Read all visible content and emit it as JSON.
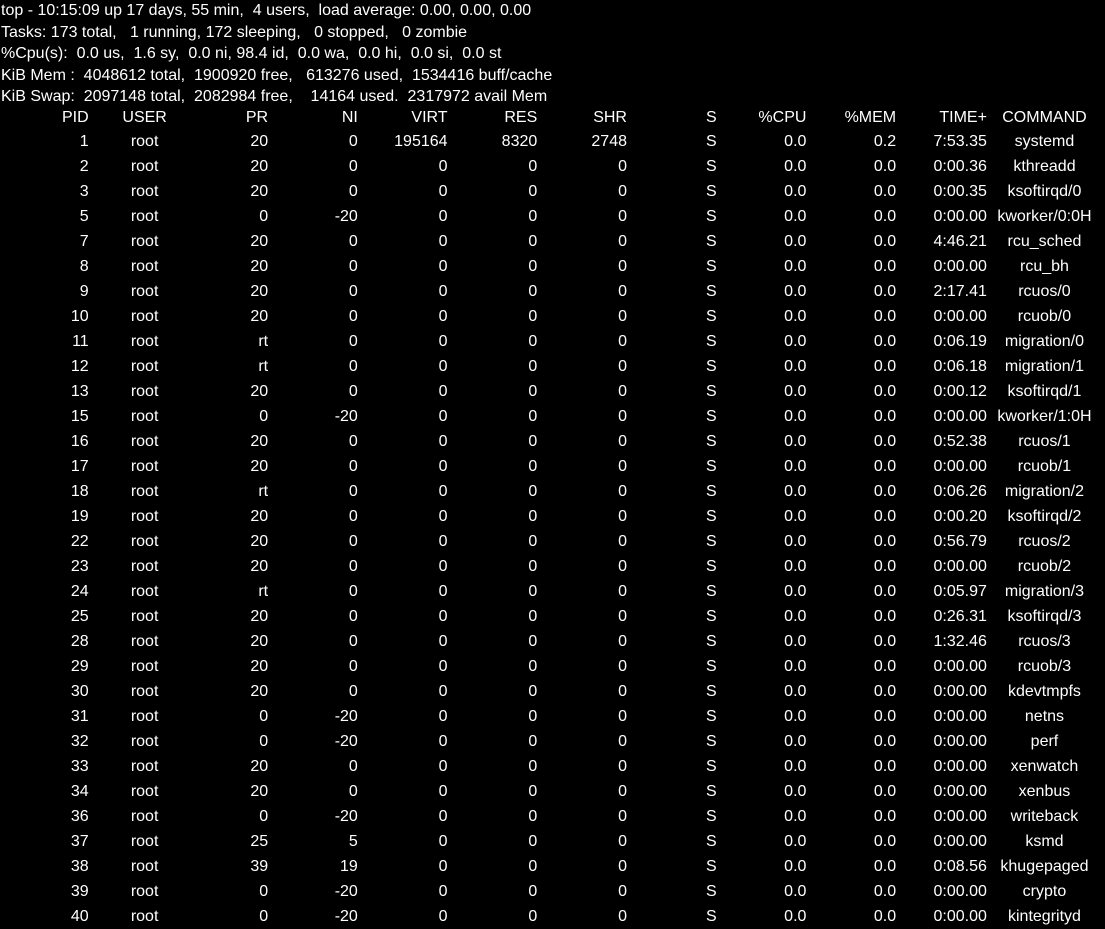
{
  "summary": {
    "line1": "top - 10:15:09 up 17 days, 55 min,  4 users,  load average: 0.00, 0.00, 0.00",
    "line2": "Tasks: 173 total,   1 running, 172 sleeping,   0 stopped,   0 zombie",
    "line3": "%Cpu(s):  0.0 us,  1.6 sy,  0.0 ni, 98.4 id,  0.0 wa,  0.0 hi,  0.0 si,  0.0 st",
    "line4": "KiB Mem :  4048612 total,  1900920 free,   613276 used,  1534416 buff/cache",
    "line5": "KiB Swap:  2097148 total,  2082984 free,    14164 used.  2317972 avail Mem"
  },
  "columns": [
    "PID",
    "USER",
    "PR",
    "NI",
    "VIRT",
    "RES",
    "SHR",
    "S",
    "%CPU",
    "%MEM",
    "TIME+",
    "COMMAND"
  ],
  "processes": [
    {
      "pid": "1",
      "user": "root",
      "pr": "20",
      "ni": "0",
      "virt": "195164",
      "res": "8320",
      "shr": "2748",
      "s": "S",
      "cpu": "0.0",
      "mem": "0.2",
      "time": "7:53.35",
      "command": "systemd"
    },
    {
      "pid": "2",
      "user": "root",
      "pr": "20",
      "ni": "0",
      "virt": "0",
      "res": "0",
      "shr": "0",
      "s": "S",
      "cpu": "0.0",
      "mem": "0.0",
      "time": "0:00.36",
      "command": "kthreadd"
    },
    {
      "pid": "3",
      "user": "root",
      "pr": "20",
      "ni": "0",
      "virt": "0",
      "res": "0",
      "shr": "0",
      "s": "S",
      "cpu": "0.0",
      "mem": "0.0",
      "time": "0:00.35",
      "command": "ksoftirqd/0"
    },
    {
      "pid": "5",
      "user": "root",
      "pr": "0",
      "ni": "-20",
      "virt": "0",
      "res": "0",
      "shr": "0",
      "s": "S",
      "cpu": "0.0",
      "mem": "0.0",
      "time": "0:00.00",
      "command": "kworker/0:0H"
    },
    {
      "pid": "7",
      "user": "root",
      "pr": "20",
      "ni": "0",
      "virt": "0",
      "res": "0",
      "shr": "0",
      "s": "S",
      "cpu": "0.0",
      "mem": "0.0",
      "time": "4:46.21",
      "command": "rcu_sched"
    },
    {
      "pid": "8",
      "user": "root",
      "pr": "20",
      "ni": "0",
      "virt": "0",
      "res": "0",
      "shr": "0",
      "s": "S",
      "cpu": "0.0",
      "mem": "0.0",
      "time": "0:00.00",
      "command": "rcu_bh"
    },
    {
      "pid": "9",
      "user": "root",
      "pr": "20",
      "ni": "0",
      "virt": "0",
      "res": "0",
      "shr": "0",
      "s": "S",
      "cpu": "0.0",
      "mem": "0.0",
      "time": "2:17.41",
      "command": "rcuos/0"
    },
    {
      "pid": "10",
      "user": "root",
      "pr": "20",
      "ni": "0",
      "virt": "0",
      "res": "0",
      "shr": "0",
      "s": "S",
      "cpu": "0.0",
      "mem": "0.0",
      "time": "0:00.00",
      "command": "rcuob/0"
    },
    {
      "pid": "11",
      "user": "root",
      "pr": "rt",
      "ni": "0",
      "virt": "0",
      "res": "0",
      "shr": "0",
      "s": "S",
      "cpu": "0.0",
      "mem": "0.0",
      "time": "0:06.19",
      "command": "migration/0"
    },
    {
      "pid": "12",
      "user": "root",
      "pr": "rt",
      "ni": "0",
      "virt": "0",
      "res": "0",
      "shr": "0",
      "s": "S",
      "cpu": "0.0",
      "mem": "0.0",
      "time": "0:06.18",
      "command": "migration/1"
    },
    {
      "pid": "13",
      "user": "root",
      "pr": "20",
      "ni": "0",
      "virt": "0",
      "res": "0",
      "shr": "0",
      "s": "S",
      "cpu": "0.0",
      "mem": "0.0",
      "time": "0:00.12",
      "command": "ksoftirqd/1"
    },
    {
      "pid": "15",
      "user": "root",
      "pr": "0",
      "ni": "-20",
      "virt": "0",
      "res": "0",
      "shr": "0",
      "s": "S",
      "cpu": "0.0",
      "mem": "0.0",
      "time": "0:00.00",
      "command": "kworker/1:0H"
    },
    {
      "pid": "16",
      "user": "root",
      "pr": "20",
      "ni": "0",
      "virt": "0",
      "res": "0",
      "shr": "0",
      "s": "S",
      "cpu": "0.0",
      "mem": "0.0",
      "time": "0:52.38",
      "command": "rcuos/1"
    },
    {
      "pid": "17",
      "user": "root",
      "pr": "20",
      "ni": "0",
      "virt": "0",
      "res": "0",
      "shr": "0",
      "s": "S",
      "cpu": "0.0",
      "mem": "0.0",
      "time": "0:00.00",
      "command": "rcuob/1"
    },
    {
      "pid": "18",
      "user": "root",
      "pr": "rt",
      "ni": "0",
      "virt": "0",
      "res": "0",
      "shr": "0",
      "s": "S",
      "cpu": "0.0",
      "mem": "0.0",
      "time": "0:06.26",
      "command": "migration/2"
    },
    {
      "pid": "19",
      "user": "root",
      "pr": "20",
      "ni": "0",
      "virt": "0",
      "res": "0",
      "shr": "0",
      "s": "S",
      "cpu": "0.0",
      "mem": "0.0",
      "time": "0:00.20",
      "command": "ksoftirqd/2"
    },
    {
      "pid": "22",
      "user": "root",
      "pr": "20",
      "ni": "0",
      "virt": "0",
      "res": "0",
      "shr": "0",
      "s": "S",
      "cpu": "0.0",
      "mem": "0.0",
      "time": "0:56.79",
      "command": "rcuos/2"
    },
    {
      "pid": "23",
      "user": "root",
      "pr": "20",
      "ni": "0",
      "virt": "0",
      "res": "0",
      "shr": "0",
      "s": "S",
      "cpu": "0.0",
      "mem": "0.0",
      "time": "0:00.00",
      "command": "rcuob/2"
    },
    {
      "pid": "24",
      "user": "root",
      "pr": "rt",
      "ni": "0",
      "virt": "0",
      "res": "0",
      "shr": "0",
      "s": "S",
      "cpu": "0.0",
      "mem": "0.0",
      "time": "0:05.97",
      "command": "migration/3"
    },
    {
      "pid": "25",
      "user": "root",
      "pr": "20",
      "ni": "0",
      "virt": "0",
      "res": "0",
      "shr": "0",
      "s": "S",
      "cpu": "0.0",
      "mem": "0.0",
      "time": "0:26.31",
      "command": "ksoftirqd/3"
    },
    {
      "pid": "28",
      "user": "root",
      "pr": "20",
      "ni": "0",
      "virt": "0",
      "res": "0",
      "shr": "0",
      "s": "S",
      "cpu": "0.0",
      "mem": "0.0",
      "time": "1:32.46",
      "command": "rcuos/3"
    },
    {
      "pid": "29",
      "user": "root",
      "pr": "20",
      "ni": "0",
      "virt": "0",
      "res": "0",
      "shr": "0",
      "s": "S",
      "cpu": "0.0",
      "mem": "0.0",
      "time": "0:00.00",
      "command": "rcuob/3"
    },
    {
      "pid": "30",
      "user": "root",
      "pr": "20",
      "ni": "0",
      "virt": "0",
      "res": "0",
      "shr": "0",
      "s": "S",
      "cpu": "0.0",
      "mem": "0.0",
      "time": "0:00.00",
      "command": "kdevtmpfs"
    },
    {
      "pid": "31",
      "user": "root",
      "pr": "0",
      "ni": "-20",
      "virt": "0",
      "res": "0",
      "shr": "0",
      "s": "S",
      "cpu": "0.0",
      "mem": "0.0",
      "time": "0:00.00",
      "command": "netns"
    },
    {
      "pid": "32",
      "user": "root",
      "pr": "0",
      "ni": "-20",
      "virt": "0",
      "res": "0",
      "shr": "0",
      "s": "S",
      "cpu": "0.0",
      "mem": "0.0",
      "time": "0:00.00",
      "command": "perf"
    },
    {
      "pid": "33",
      "user": "root",
      "pr": "20",
      "ni": "0",
      "virt": "0",
      "res": "0",
      "shr": "0",
      "s": "S",
      "cpu": "0.0",
      "mem": "0.0",
      "time": "0:00.00",
      "command": "xenwatch"
    },
    {
      "pid": "34",
      "user": "root",
      "pr": "20",
      "ni": "0",
      "virt": "0",
      "res": "0",
      "shr": "0",
      "s": "S",
      "cpu": "0.0",
      "mem": "0.0",
      "time": "0:00.00",
      "command": "xenbus"
    },
    {
      "pid": "36",
      "user": "root",
      "pr": "0",
      "ni": "-20",
      "virt": "0",
      "res": "0",
      "shr": "0",
      "s": "S",
      "cpu": "0.0",
      "mem": "0.0",
      "time": "0:00.00",
      "command": "writeback"
    },
    {
      "pid": "37",
      "user": "root",
      "pr": "25",
      "ni": "5",
      "virt": "0",
      "res": "0",
      "shr": "0",
      "s": "S",
      "cpu": "0.0",
      "mem": "0.0",
      "time": "0:00.00",
      "command": "ksmd"
    },
    {
      "pid": "38",
      "user": "root",
      "pr": "39",
      "ni": "19",
      "virt": "0",
      "res": "0",
      "shr": "0",
      "s": "S",
      "cpu": "0.0",
      "mem": "0.0",
      "time": "0:08.56",
      "command": "khugepaged"
    },
    {
      "pid": "39",
      "user": "root",
      "pr": "0",
      "ni": "-20",
      "virt": "0",
      "res": "0",
      "shr": "0",
      "s": "S",
      "cpu": "0.0",
      "mem": "0.0",
      "time": "0:00.00",
      "command": "crypto"
    },
    {
      "pid": "40",
      "user": "root",
      "pr": "0",
      "ni": "-20",
      "virt": "0",
      "res": "0",
      "shr": "0",
      "s": "S",
      "cpu": "0.0",
      "mem": "0.0",
      "time": "0:00.00",
      "command": "kintegrityd"
    }
  ]
}
